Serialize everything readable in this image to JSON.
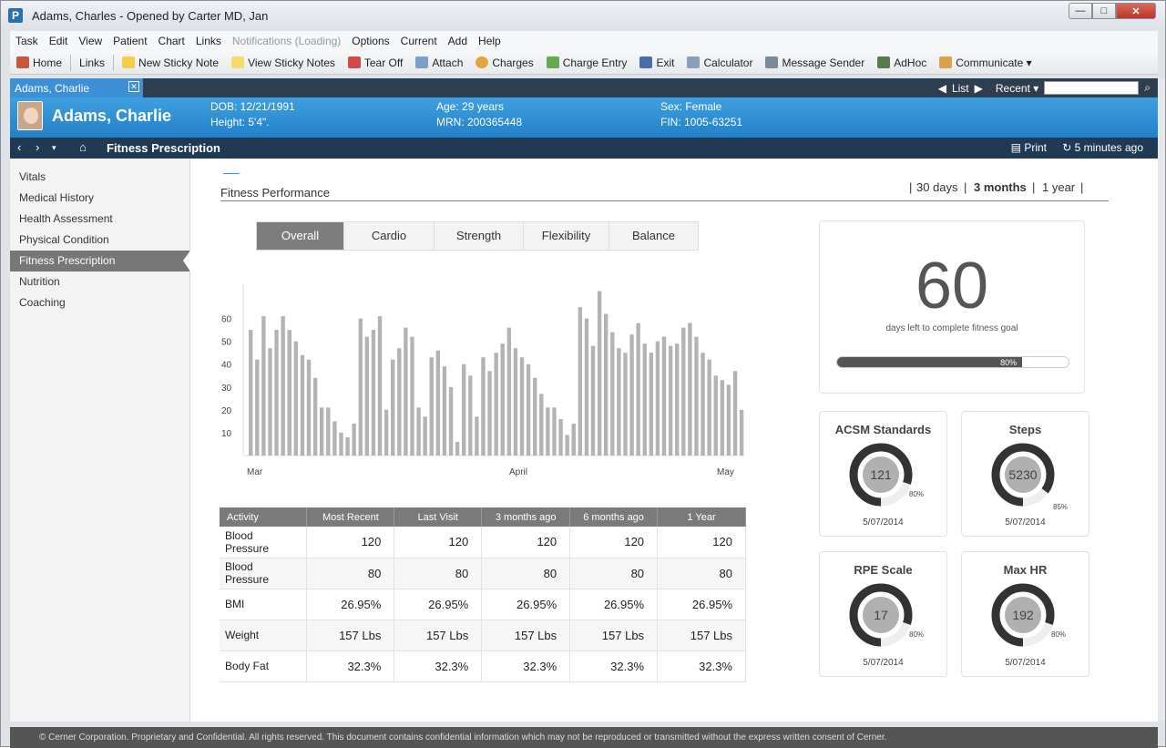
{
  "window": {
    "title": "Adams, Charles - Opened by Carter MD, Jan",
    "app_letter": "P",
    "close": "✕",
    "minimize": "—",
    "maximize": "□"
  },
  "menu": [
    "Task",
    "Edit",
    "View",
    "Patient",
    "Chart",
    "Links",
    "Notifications (Loading)",
    "Options",
    "Current",
    "Add",
    "Help"
  ],
  "toolbar": {
    "home": "Home",
    "links": "Links",
    "new_sticky": "New Sticky Note",
    "view_sticky": "View Sticky Notes",
    "tear_off": "Tear Off",
    "attach": "Attach",
    "charges": "Charges",
    "charge_entry": "Charge Entry",
    "exit": "Exit",
    "calculator": "Calculator",
    "message_sender": "Message Sender",
    "adhoc": "AdHoc",
    "communicate": "Communicate ▾"
  },
  "tabbar": {
    "patient_tab": "Adams, Charlie",
    "tab_close": "✕",
    "list": "List",
    "recent": "Recent ▾"
  },
  "patient": {
    "name": "Adams, Charlie",
    "dob": "DOB: 12/21/1991",
    "height": "Height: 5'4\".",
    "age": "Age: 29 years",
    "mrn": "MRN: 200365448",
    "sex": "Sex: Female",
    "fin": "FIN: 1005-63251"
  },
  "nav": {
    "page_title": "Fitness Prescription",
    "print": "Print",
    "refreshed": "5 minutes ago"
  },
  "sidebar": [
    "Vitals",
    "Medical History",
    "Health Assessment",
    "Physical Condition",
    "Fitness Prescription",
    "Nutrition",
    "Coaching"
  ],
  "section": {
    "title": "Fitness Performance",
    "range_30": "30 days",
    "range_3m": "3 months",
    "range_1y": "1 year",
    "sep": "|"
  },
  "segments": [
    "Overall",
    "Cardio",
    "Strength",
    "Flexibility",
    "Balance"
  ],
  "chart_data": {
    "type": "bar",
    "x_labels": [
      "Mar",
      "April",
      "May"
    ],
    "y_ticks": [
      10,
      20,
      30,
      40,
      50,
      60
    ],
    "ylim": [
      0,
      75
    ],
    "values": [
      55,
      42,
      61,
      47,
      55,
      61,
      55,
      50,
      44,
      42,
      34,
      21,
      21,
      15,
      10,
      8,
      14,
      60,
      52,
      55,
      61,
      20,
      42,
      47,
      56,
      52,
      21,
      17,
      43,
      46,
      39,
      30,
      6,
      40,
      35,
      17,
      43,
      37,
      45,
      49,
      56,
      47,
      43,
      40,
      34,
      27,
      21,
      21,
      16,
      9,
      14,
      65,
      60,
      48,
      72,
      62,
      54,
      47,
      45,
      53,
      58,
      49,
      45,
      50,
      52,
      48,
      49,
      56,
      58,
      52,
      45,
      42,
      35,
      33,
      31,
      37,
      20
    ]
  },
  "table": {
    "headers": [
      "Activity",
      "Most Recent",
      "Last Visit",
      "3 months ago",
      "6 months ago",
      "1 Year"
    ],
    "rows": [
      [
        "Blood Pressure",
        "120",
        "120",
        "120",
        "120",
        "120"
      ],
      [
        "Blood Pressure",
        "80",
        "80",
        "80",
        "80",
        "80"
      ],
      [
        "BMI",
        "26.95%",
        "26.95%",
        "26.95%",
        "26.95%",
        "26.95%"
      ],
      [
        "Weight",
        "157 Lbs",
        "157 Lbs",
        "157 Lbs",
        "157 Lbs",
        "157 Lbs"
      ],
      [
        "Body Fat",
        "32.3%",
        "32.3%",
        "32.3%",
        "32.3%",
        "32.3%"
      ]
    ]
  },
  "goal": {
    "days": "60",
    "label": "days left to complete fitness goal",
    "progress_label": "80%",
    "progress": 0.8
  },
  "metrics": [
    {
      "title": "ACSM Standards",
      "value": "121",
      "pct_label": "80%",
      "pct": 0.8,
      "date": "5/07/2014"
    },
    {
      "title": "Steps",
      "value": "5230",
      "pct_label": "85%",
      "pct": 0.85,
      "date": "5/07/2014"
    },
    {
      "title": "RPE Scale",
      "value": "17",
      "pct_label": "80%",
      "pct": 0.8,
      "date": "5/07/2014"
    },
    {
      "title": "Max HR",
      "value": "192",
      "pct_label": "80%",
      "pct": 0.8,
      "date": "5/07/2014"
    }
  ],
  "footer": "© Cerner Corporation. Proprietary and Confidential. All rights reserved. This document contains confidential information which may not be reproduced or transmitted without the express written consent of Cerner.",
  "colors": {
    "banner": "#2a8bd4",
    "nav": "#1f3a55",
    "bar": "#b3b3b3",
    "ring": "#333333"
  }
}
